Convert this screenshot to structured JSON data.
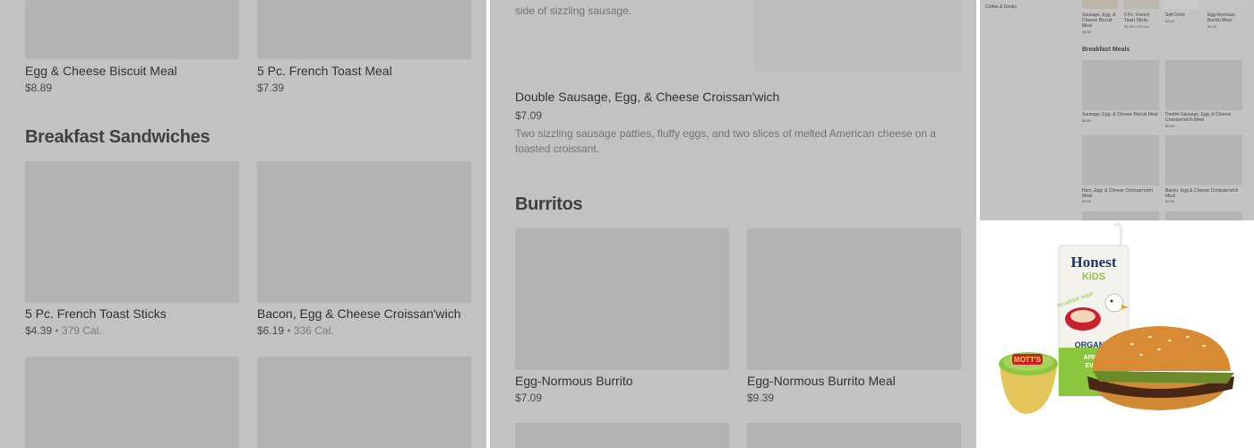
{
  "left": {
    "row1": [
      {
        "name": "Egg & Cheese Biscuit Meal",
        "price": "$8.89",
        "cal": ""
      },
      {
        "name": "5 Pc. French Toast Meal",
        "price": "$7.39",
        "cal": ""
      }
    ],
    "section_title": "Breakfast Sandwiches",
    "row2": [
      {
        "name": "5 Pc. French Toast Sticks",
        "price": "$4.39",
        "sep": " • ",
        "cal": "379 Cal."
      },
      {
        "name": "Bacon, Egg & Cheese Croissan'wich",
        "price": "$6.19",
        "sep": " • ",
        "cal": "336 Cal."
      }
    ]
  },
  "middle": {
    "top_desc": "side of sizzling sausage.",
    "featured": {
      "name": "Double Sausage, Egg, & Cheese Croissan'wich",
      "price": "$7.09",
      "description": "Two sizzling sausage patties, fluffy eggs, and two slices of melted American cheese on a toasted croissant."
    },
    "section_title": "Burritos",
    "items": [
      {
        "name": "Egg-Normous Burrito",
        "price": "$7.09"
      },
      {
        "name": "Egg-Normous Burrito Meal",
        "price": "$9.39"
      }
    ]
  },
  "mini": {
    "sidebar_item": "Coffee & Drinks",
    "top_row": [
      {
        "name": "Sausage, Egg, & Cheese Biscuit Meal",
        "price": "$8.89",
        "cal": ""
      },
      {
        "name": "5 Pc. French Toast Sticks",
        "price": "$4.39",
        "cal": "379 Cal."
      },
      {
        "name": "Soft Drink",
        "price": "$3.59",
        "cal": ""
      },
      {
        "name": "Egg-Normous Burrito Meal",
        "price": "$9.39",
        "cal": ""
      }
    ],
    "section_title": "Breakfast Meals",
    "grid": [
      {
        "name": "Sausage, Egg, & Cheese Biscuit Meal",
        "price": "$8.89"
      },
      {
        "name": "Double Sausage, Egg, & Cheese Croissan'wich Meal",
        "price": "$9.89"
      },
      {
        "name": "Ham, Egg, & Cheese Croissan'wich Meal",
        "price": "$9.89"
      },
      {
        "name": "Bacon, Egg & Cheese Croissan'wich Meal",
        "price": "$9.89"
      }
    ]
  },
  "product_image": {
    "brand": "Honest",
    "sub_brand": "KiDS",
    "claim": "No added sugar",
    "organic": "ORGANIC",
    "flavor": "APPLE",
    "flavor2": "EVER",
    "cup_brand": "MOTT'S"
  },
  "colors": {
    "overlay_gray": "#c2c2c2",
    "placeholder_gray": "#b3b3b3",
    "text_dark": "#333333"
  }
}
